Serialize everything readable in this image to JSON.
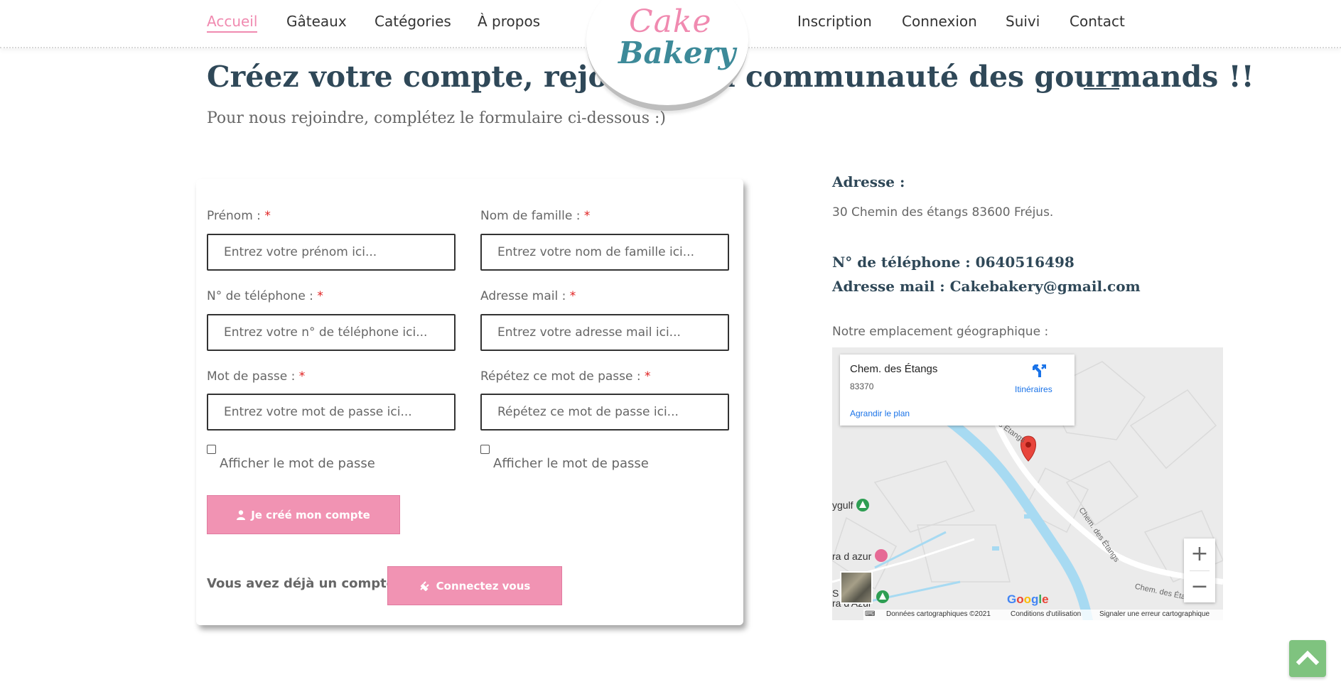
{
  "nav": {
    "left": [
      "Accueil",
      "Gâteaux",
      "Catégories",
      "À propos"
    ],
    "right": [
      "Inscription",
      "Connexion",
      "Suivi",
      "Contact"
    ],
    "active": "Accueil",
    "logo_top": "Cake",
    "logo_bottom": "Bakery"
  },
  "page": {
    "title": "Créez votre compte, rejoignez la communauté des gourmands !!",
    "subtitle": "Pour nous rejoindre, complétez le formulaire ci-dessous :)"
  },
  "form": {
    "required_mark": "*",
    "firstname": {
      "label": "Prénom :",
      "placeholder": "Entrez votre prénom ici..."
    },
    "lastname": {
      "label": "Nom de famille :",
      "placeholder": "Entrez votre nom de famille ici..."
    },
    "phone": {
      "label": "N° de téléphone :",
      "placeholder": "Entrez votre n° de téléphone ici..."
    },
    "email": {
      "label": "Adresse mail :",
      "placeholder": "Entrez votre adresse mail ici..."
    },
    "password": {
      "label": "Mot de passe :",
      "placeholder": "Entrez votre mot de passe ici..."
    },
    "password_repeat": {
      "label": "Répétez ce mot de passe :",
      "placeholder": "Répétez ce mot de passe ici..."
    },
    "show_password": "Afficher le mot de passe",
    "submit": "Je créé mon compte",
    "already": "Vous avez déjà un compte ?",
    "login": "Connectez vous"
  },
  "contact": {
    "address_title": "Adresse :",
    "address": "30 Chemin des étangs 83600 Fréjus.",
    "phone_label": "N° de téléphone :",
    "phone": "0640516498",
    "email_label": "Adresse mail :",
    "email": "Cakebakery@gmail.com",
    "location_label": "Notre emplacement géographique :"
  },
  "map": {
    "place": "Chem. des Étangs",
    "zip": "83370",
    "directions": "Itinéraires",
    "enlarge": "Agrandir le plan",
    "road_label": "Chem. des Étangs",
    "poi1": "ygulf",
    "poi2": "ra d azur",
    "poi3": "S",
    "poi4": "ra d'Azur",
    "google": "Google",
    "footer_data": "Données cartographiques ©2021",
    "footer_terms": "Conditions d'utilisation",
    "footer_report": "Signaler une erreur cartographique",
    "zoom_in": "+",
    "zoom_out": "−"
  },
  "colors": {
    "accent_pink": "#f193b3",
    "heading": "#2f4858",
    "teal_logo": "#3d8a99",
    "scroll_top": "#7fc37f"
  }
}
